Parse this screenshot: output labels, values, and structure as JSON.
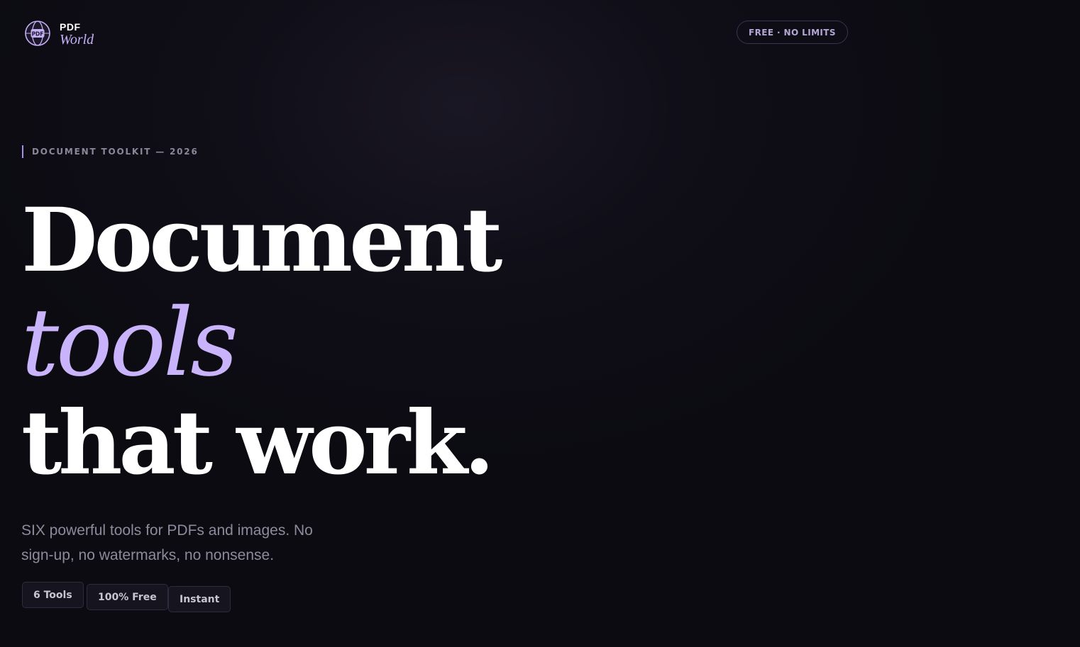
{
  "header": {
    "logo_top": "PDF",
    "logo_bottom": "World",
    "logo_icon": "globe-pdf-icon",
    "badge": "FREE · NO LIMITS"
  },
  "hero": {
    "eyebrow": "DOCUMENT TOOLKIT — 2026",
    "line1": "Document",
    "line2": "tools",
    "line3": "that work.",
    "subtitle": "SIX powerful tools for PDFs and images. No sign-up, no watermarks, no nonsense.",
    "chips": [
      "6 Tools",
      "100% Free",
      "Instant"
    ]
  },
  "colors": {
    "background": "#0c0b12",
    "accent": "#c9b4fb",
    "muted_text": "#8e8a9c"
  }
}
